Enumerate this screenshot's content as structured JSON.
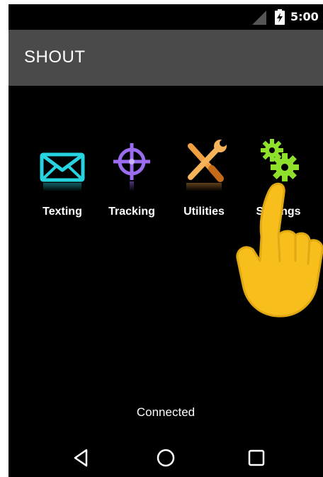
{
  "status_bar": {
    "time": "5:00",
    "icons": [
      "signal-icon",
      "battery-charging-icon"
    ]
  },
  "app_bar": {
    "title": "SHOUT"
  },
  "tiles": [
    {
      "label": "Texting",
      "icon": "envelope-icon",
      "color": "#27d3e0"
    },
    {
      "label": "Tracking",
      "icon": "crosshair-icon",
      "color": "#9b6cf0"
    },
    {
      "label": "Utilities",
      "icon": "tools-icon",
      "color": "#f0a040"
    },
    {
      "label": "Settings",
      "icon": "gears-icon",
      "color": "#8ee02a"
    }
  ],
  "overlay": {
    "icon": "pointing-hand-icon",
    "color": "#f8bf1c"
  },
  "status": {
    "connection": "Connected"
  },
  "nav_bar": {
    "icons": [
      "back-icon",
      "home-icon",
      "recents-icon"
    ]
  }
}
